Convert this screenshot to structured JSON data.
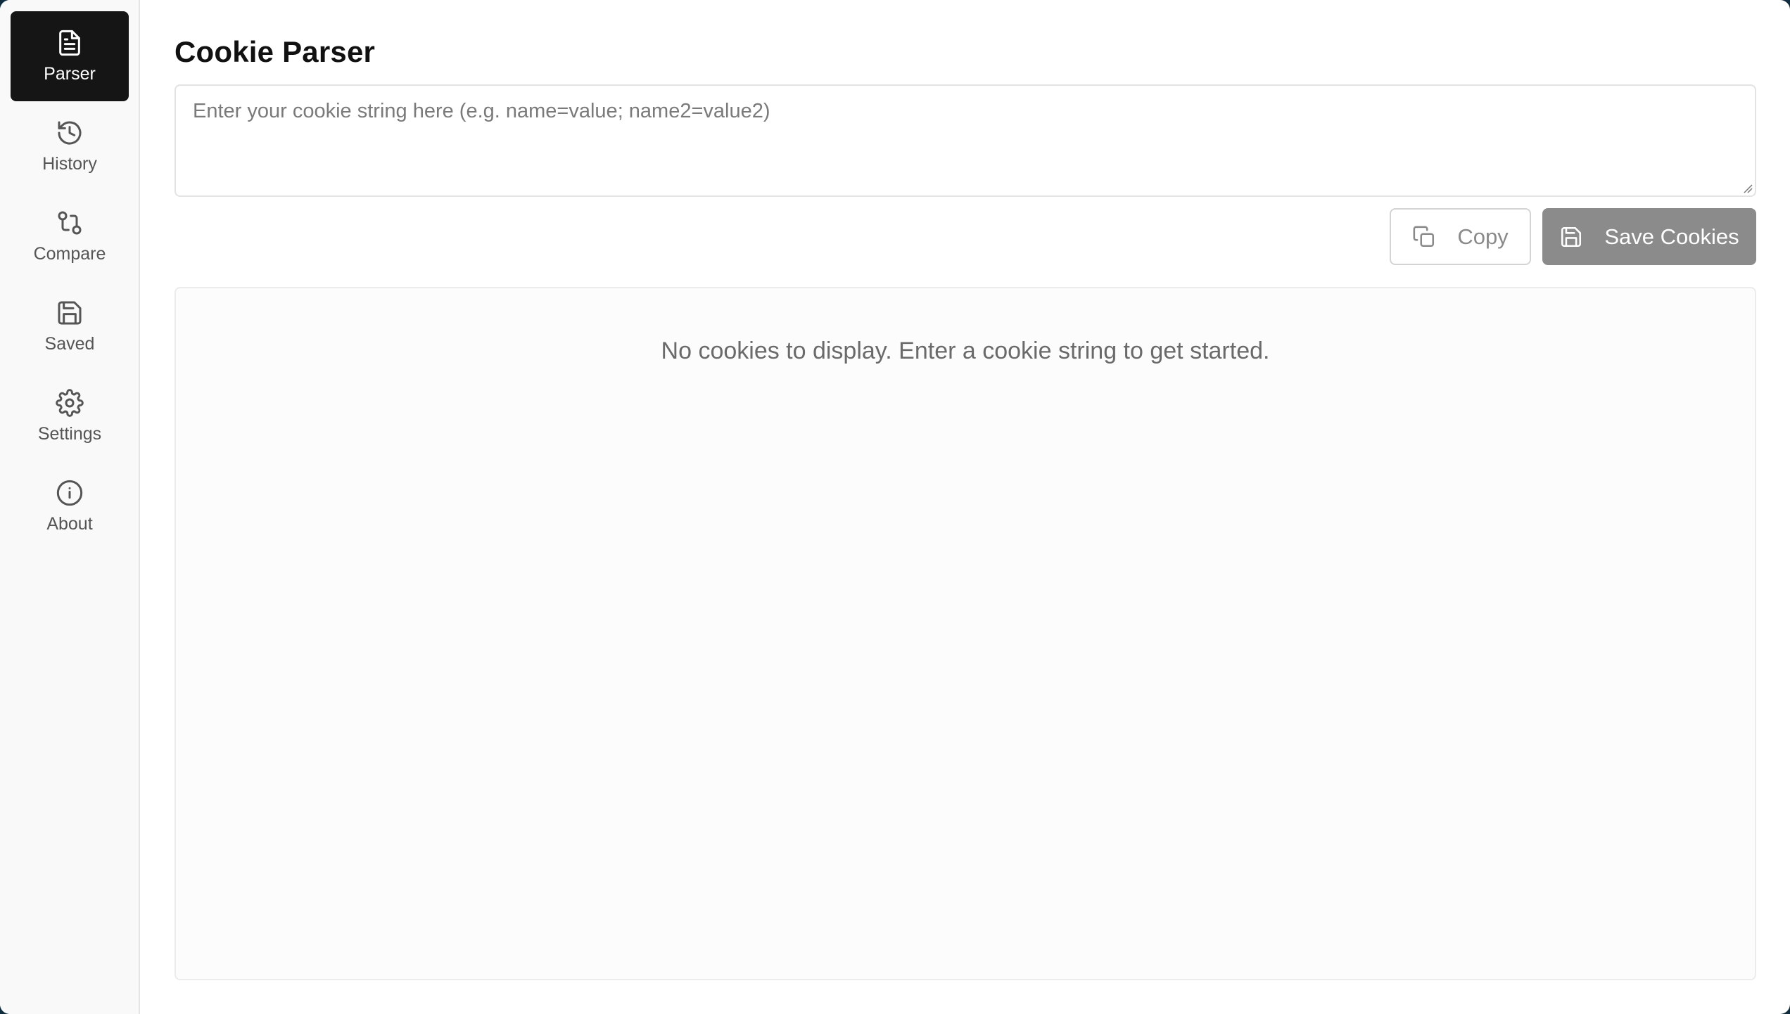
{
  "sidebar": {
    "items": [
      {
        "label": "Parser",
        "icon": "document-icon",
        "active": true
      },
      {
        "label": "History",
        "icon": "history-icon",
        "active": false
      },
      {
        "label": "Compare",
        "icon": "compare-icon",
        "active": false
      },
      {
        "label": "Saved",
        "icon": "save-icon",
        "active": false
      },
      {
        "label": "Settings",
        "icon": "gear-icon",
        "active": false
      },
      {
        "label": "About",
        "icon": "info-icon",
        "active": false
      }
    ]
  },
  "main": {
    "title": "Cookie Parser",
    "input": {
      "value": "",
      "placeholder": "Enter your cookie string here (e.g. name=value; name2=value2)"
    },
    "buttons": {
      "copy_label": "Copy",
      "save_label": "Save Cookies"
    },
    "empty_message": "No cookies to display. Enter a cookie string to get started."
  },
  "colors": {
    "active_nav_bg": "#151515",
    "save_button_bg": "#8b8b8b",
    "sidebar_bg": "#f9f9f9"
  }
}
